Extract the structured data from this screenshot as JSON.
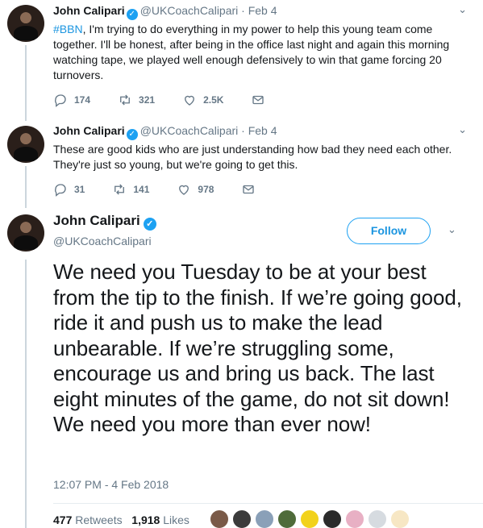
{
  "thread": [
    {
      "name": "John Calipari",
      "handle": "@UKCoachCalipari",
      "date": "· Feb 4",
      "hashtag": "#BBN",
      "text": ", I'm trying to do everything in my power to help this young team come together. I'll be honest, after being in the office last night and again this morning watching tape, we played well enough defensively to win that game forcing 20 turnovers.",
      "replies": "174",
      "retweets": "321",
      "likes": "2.5K"
    },
    {
      "name": "John Calipari",
      "handle": "@UKCoachCalipari",
      "date": "· Feb 4",
      "hashtag": "",
      "text": "These are good kids who are just understanding how bad they need each other. They're just so young, but we're going to get this.",
      "replies": "31",
      "retweets": "141",
      "likes": "978"
    }
  ],
  "main": {
    "name": "John Calipari",
    "handle": "@UKCoachCalipari",
    "follow_label": "Follow",
    "text": "We need you Tuesday to be at your best from the tip to the finish. If we’re going good, ride it and push us to make the lead unbearable. If we’re struggling some, encourage us and bring us back. The last eight minutes of the game, do not sit down! We need you more than ever now!",
    "timestamp": "12:07 PM - 4 Feb 2018",
    "retweet_count": "477",
    "retweet_label": "Retweets",
    "like_count": "1,918",
    "like_label": "Likes"
  },
  "colors": {
    "brand": "#1da1f2",
    "muted": "#657786"
  },
  "icons": [
    "reply-icon",
    "retweet-icon",
    "like-icon",
    "message-icon",
    "verified-icon",
    "chevron-down-icon"
  ]
}
